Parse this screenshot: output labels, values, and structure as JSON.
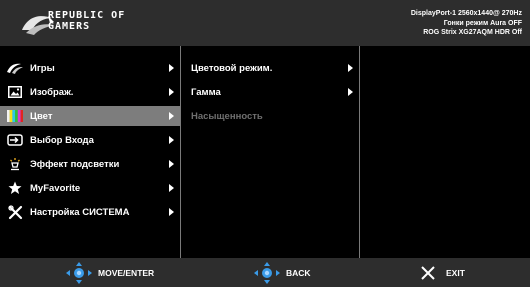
{
  "header": {
    "logo_line1": "REPUBLIC OF",
    "logo_line2": "GAMERS",
    "status_line1": "DisplayPort-1 2560x1440@ 270Hz",
    "status_line2": "Гонки режим Aura OFF",
    "status_line3": "ROG Strix XG27AQM HDR Off"
  },
  "main_menu": {
    "items": [
      {
        "label": "Игры",
        "icon": "rog-eye-icon"
      },
      {
        "label": "Изображ.",
        "icon": "image-icon"
      },
      {
        "label": "Цвет",
        "icon": "color-bars-icon"
      },
      {
        "label": "Выбор Входа",
        "icon": "input-icon"
      },
      {
        "label": "Эффект подсветки",
        "icon": "light-effect-icon"
      },
      {
        "label": "MyFavorite",
        "icon": "star-icon"
      },
      {
        "label": "Настройка СИСТЕМА",
        "icon": "tools-icon"
      }
    ],
    "selected": "Цвет"
  },
  "submenu": {
    "items": [
      {
        "label": "Цветовой режим."
      },
      {
        "label": "Гамма"
      },
      {
        "label": "Насыщенность"
      }
    ]
  },
  "footer": {
    "move_label": "MOVE/ENTER",
    "back_label": "BACK",
    "exit_label": "EXIT"
  },
  "colors": {
    "panel_bg": "#2d2d2d",
    "selected_bg": "#7d7d7d",
    "joystick_blue": "#3a9be8",
    "disabled_text": "#6f6f6f"
  }
}
